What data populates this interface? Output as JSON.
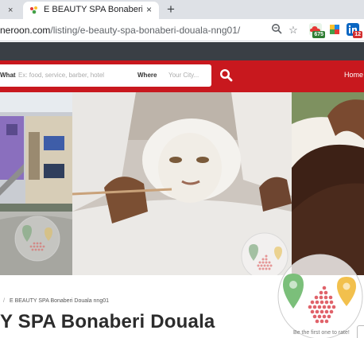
{
  "browser": {
    "prev_tab": {
      "close": "×"
    },
    "active_tab": {
      "title": "E BEAUTY SPA Bonaberi Douala -",
      "close": "×"
    },
    "new_tab": "+",
    "address": {
      "url_main": "neroon.com",
      "url_path": "/listing/e-beauty-spa-bonaberi-douala-nng01/"
    },
    "extensions": [
      {
        "name": "cloud-extension-icon",
        "badge": "675",
        "badge_color": "#2e7d32"
      },
      {
        "name": "puzzle-extension-icon",
        "badge": "",
        "badge_color": ""
      },
      {
        "name": "linkedin-extension-icon",
        "badge": "12",
        "badge_color": "#d32f2f"
      }
    ]
  },
  "header": {
    "what_label": "What",
    "what_placeholder": "Ex: food, service, barber, hotel",
    "where_label": "Where",
    "where_placeholder": "Your City...",
    "home_link": "Home",
    "brand_red": "#c8181e"
  },
  "breadcrumb": {
    "separator": "/",
    "current": "E BEAUTY SPA Bonaberi Douala nng01"
  },
  "listing": {
    "title": "Y SPA Bonaberi Douala",
    "rating_text": "Be the first one to rate!"
  }
}
